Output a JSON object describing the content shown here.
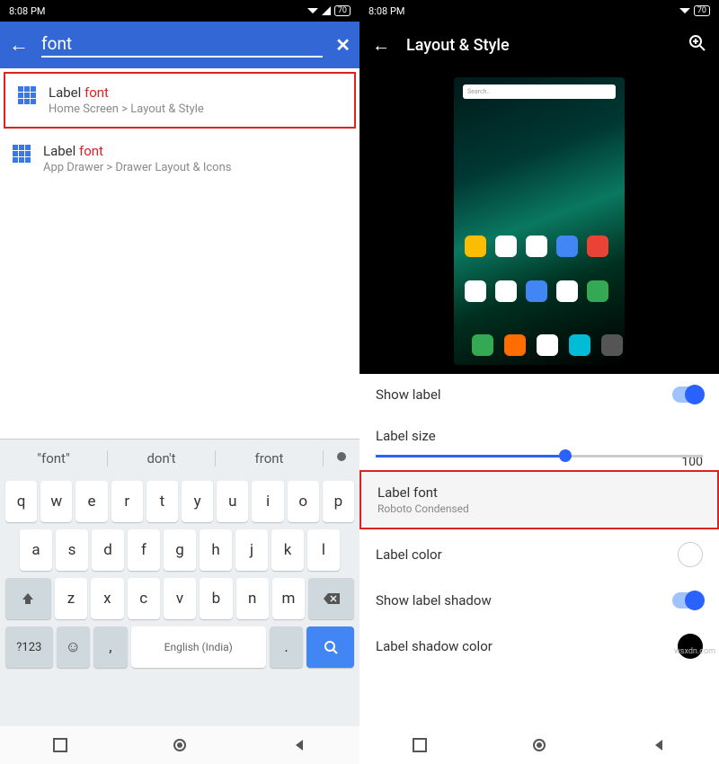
{
  "statusbar": {
    "time": "8:08 PM",
    "battery": "70"
  },
  "left": {
    "search_query": "font",
    "results": [
      {
        "label_pre": "Label ",
        "label_match": "font",
        "path": "Home Screen > Layout & Style",
        "highlighted": true
      },
      {
        "label_pre": "Label ",
        "label_match": "font",
        "path": "App Drawer > Drawer Layout & Icons",
        "highlighted": false
      }
    ],
    "suggestions": [
      "\"font\"",
      "don't",
      "front"
    ],
    "keyboard": {
      "row1": [
        "q",
        "w",
        "e",
        "r",
        "t",
        "y",
        "u",
        "i",
        "o",
        "p"
      ],
      "row2": [
        "a",
        "s",
        "d",
        "f",
        "g",
        "h",
        "j",
        "k",
        "l"
      ],
      "row3": [
        "z",
        "x",
        "c",
        "v",
        "b",
        "n",
        "m"
      ],
      "lang": "English (India)",
      "numkey": "?123"
    }
  },
  "right": {
    "title": "Layout & Style",
    "preview_search_placeholder": "Search..",
    "settings": {
      "show_label": "Show label",
      "label_size": "Label size",
      "label_size_value": "100",
      "label_font": "Label font",
      "label_font_value": "Roboto Condensed",
      "label_color": "Label color",
      "show_label_shadow": "Show label shadow",
      "label_shadow_color": "Label shadow color"
    }
  },
  "watermark": "wsxdn.com"
}
